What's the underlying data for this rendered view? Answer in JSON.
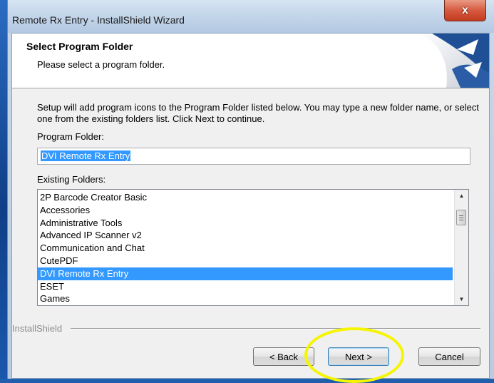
{
  "window": {
    "title": "Remote Rx Entry - InstallShield Wizard",
    "close_glyph": "x"
  },
  "header": {
    "title": "Select Program Folder",
    "subtitle": "Please select a program folder."
  },
  "body": {
    "description": "Setup will add program icons to the Program Folder listed below.  You may type a new folder name, or select one from the existing folders list.  Click Next to continue.",
    "program_folder_label": "Program Folder:",
    "program_folder_value": "DVI Remote Rx Entry",
    "existing_folders_label": "Existing Folders:",
    "existing_folders": [
      "2P Barcode Creator Basic",
      "Accessories",
      "Administrative Tools",
      "Advanced IP Scanner v2",
      "Communication and Chat",
      "CutePDF",
      "DVI Remote Rx Entry",
      "ESET",
      "Games"
    ],
    "selected_folder": "DVI Remote Rx Entry"
  },
  "footer": {
    "brand": "InstallShield",
    "back_label": "< Back",
    "next_label": "Next >",
    "cancel_label": "Cancel"
  },
  "annotation": {
    "highlight_color": "#f5f500"
  }
}
